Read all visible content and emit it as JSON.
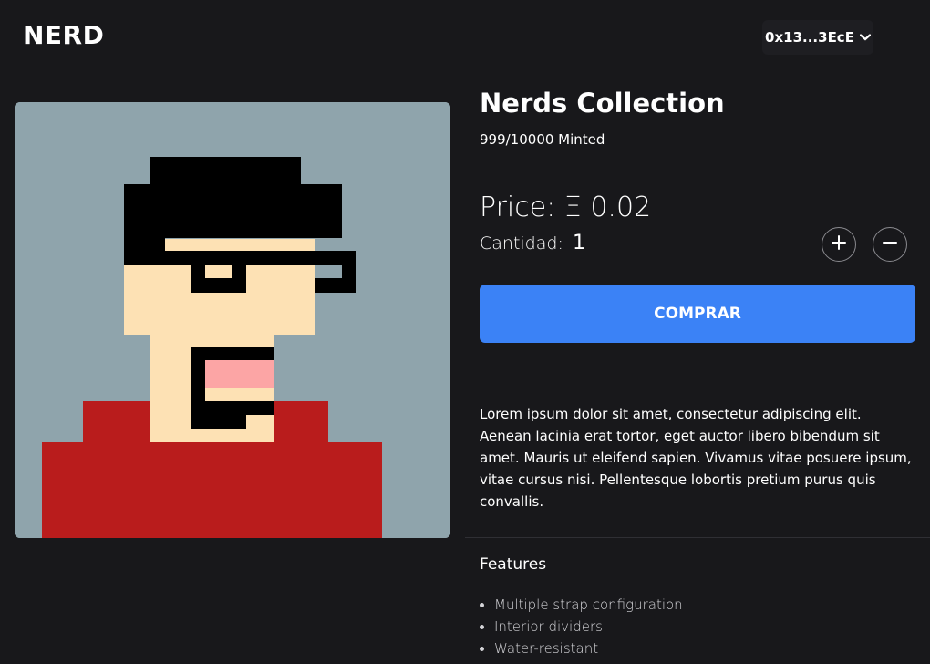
{
  "header": {
    "logo": "NERD",
    "wallet_address": "0x13...3EcE",
    "wallet_chevron_icon": "chevron-down-icon"
  },
  "nft": {
    "title": "Nerds Collection",
    "minted": "999/10000 Minted",
    "price": "Price: Ξ 0.02",
    "quantity_label": "Cantidad:",
    "quantity_value": "1",
    "buy_label": "COMPRAR",
    "description": "Lorem ipsum dolor sit amet, consectetur adipiscing elit. Aenean lacinia erat tortor, eget auctor libero bibendum sit amet. Mauris ut eleifend sapien. Vivamus vitae posuere ipsum, vitae cursus nisi. Pellentesque lobortis pretium purus quis convallis."
  },
  "features": {
    "title": "Features",
    "items": [
      "Multiple strap configuration",
      "Interior dividers",
      "Water-resistant"
    ]
  },
  "colors": {
    "background": "#18181b",
    "accent": "#3b82f6",
    "art_background": "#8fa4ac",
    "shirt": "#b91c1c",
    "skin": "#fde1b4",
    "mouth": "#fca5a5"
  }
}
